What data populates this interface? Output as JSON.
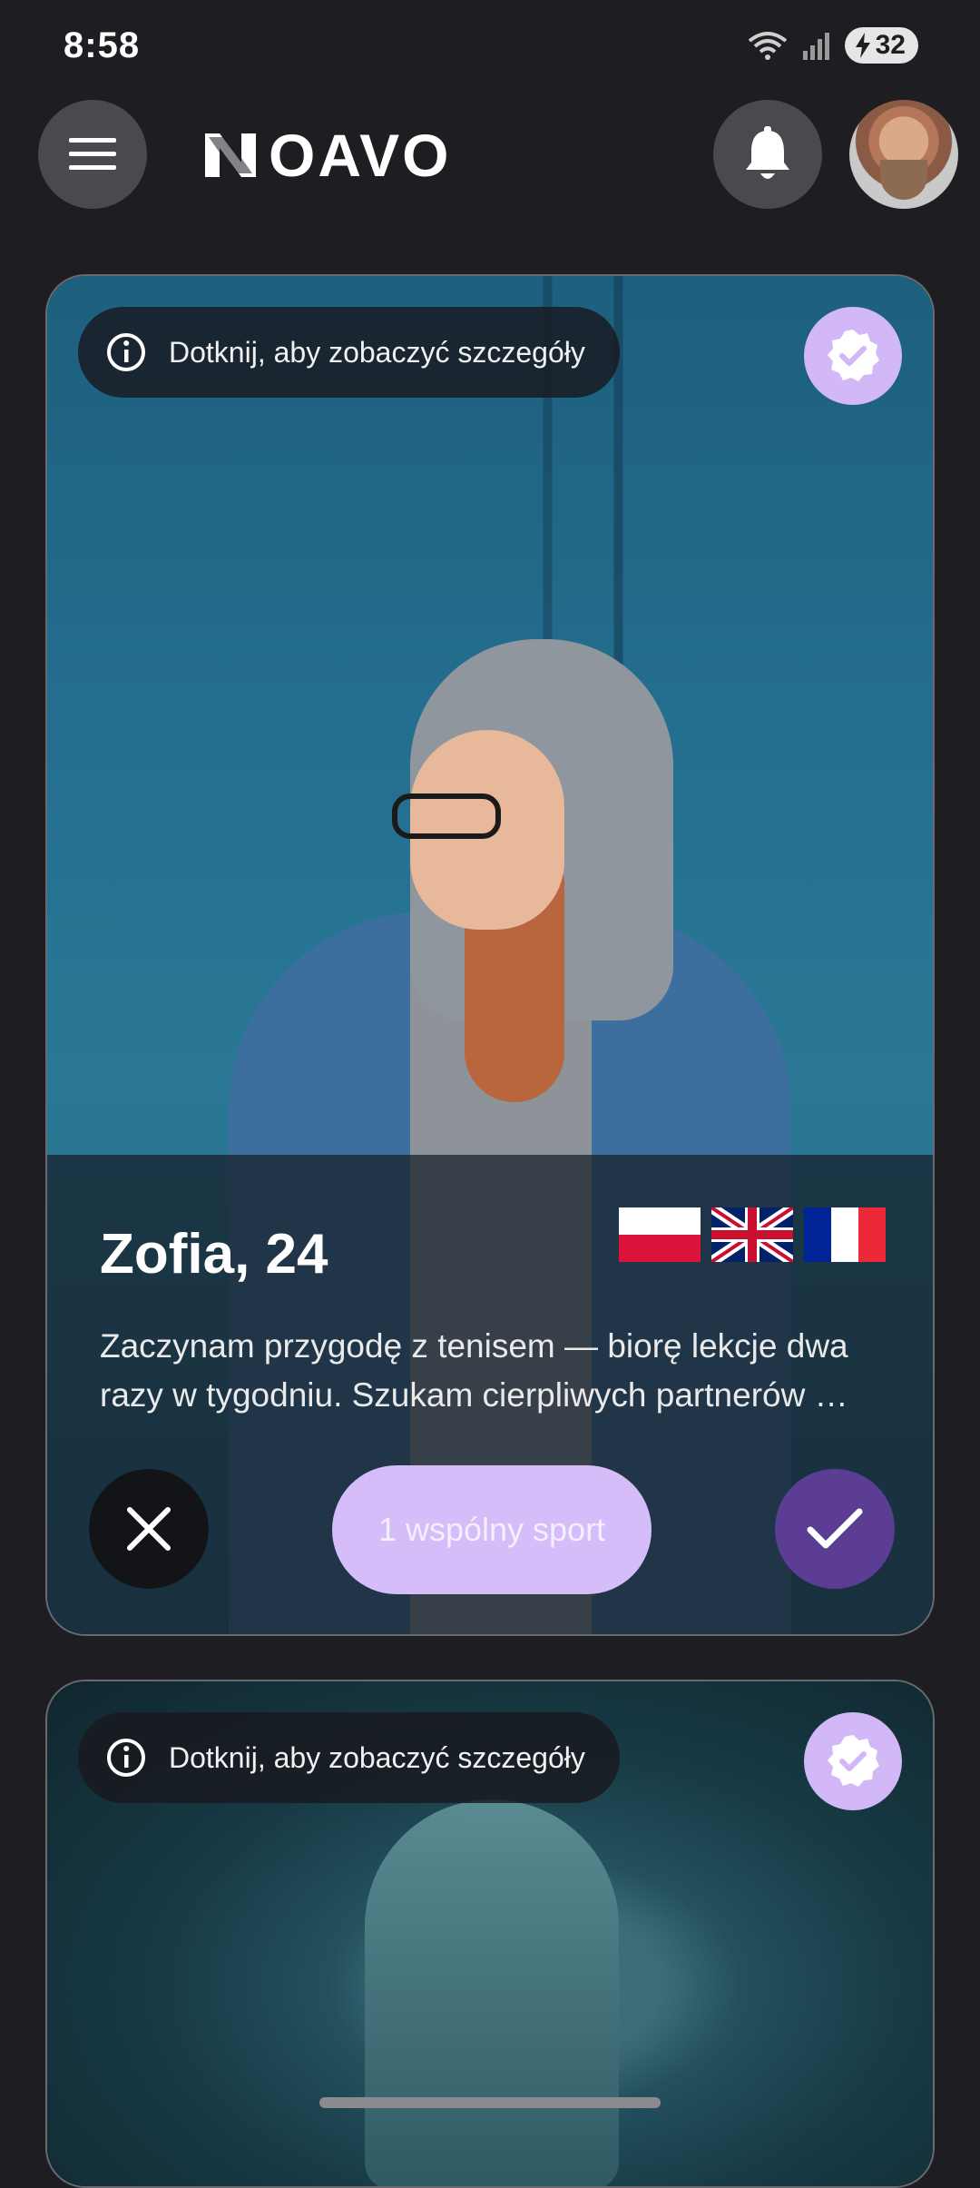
{
  "status_bar": {
    "time": "8:58",
    "battery": "32"
  },
  "header": {
    "logo_text": "OAVO"
  },
  "cards": [
    {
      "hint": "Dotknij, aby zobaczyć szczegóły",
      "name_age": "Zofia, 24",
      "bio": "Zaczynam przygodę z tenisem — biorę lekcje dwa razy w tygodniu. Szukam cierpliwych partnerów …",
      "common_sport": "1 wspólny sport",
      "languages": [
        "pl-flag-icon",
        "uk-flag-icon",
        "fr-flag-icon"
      ]
    },
    {
      "hint": "Dotknij, aby zobaczyć szczegóły"
    }
  ],
  "colors": {
    "background": "#1e1d22",
    "accent": "#5b3e94",
    "pill": "#d4bdf9",
    "badge": "#d2b8f6"
  }
}
